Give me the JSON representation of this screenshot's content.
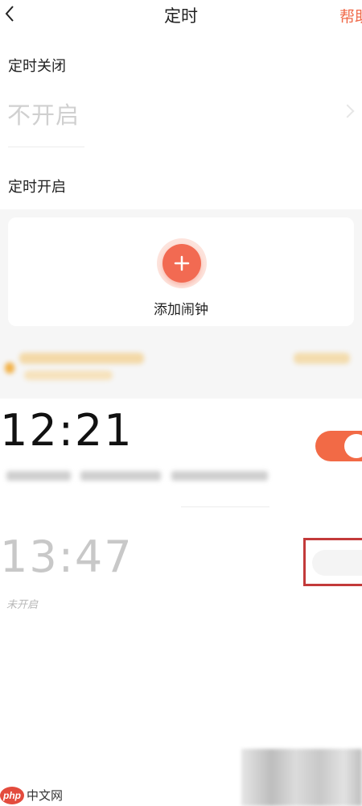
{
  "header": {
    "title": "定时",
    "help_label": "帮助"
  },
  "timer_off": {
    "label": "定时关闭",
    "value": "不开启"
  },
  "timer_on": {
    "label": "定时开启",
    "add_label": "添加闹钟"
  },
  "alarms": [
    {
      "time": "12:21",
      "enabled": true
    },
    {
      "time": "13:47",
      "status": "未开启",
      "enabled": false
    }
  ],
  "watermark": {
    "logo": "php",
    "text": "中文网"
  },
  "colors": {
    "accent": "#f26a52",
    "toggle_on": "#f26a46",
    "highlight_box": "#c33a3a"
  },
  "icons": {
    "back": "chevron-left-icon",
    "add": "plus-icon",
    "chevron": "chevron-right-icon"
  }
}
